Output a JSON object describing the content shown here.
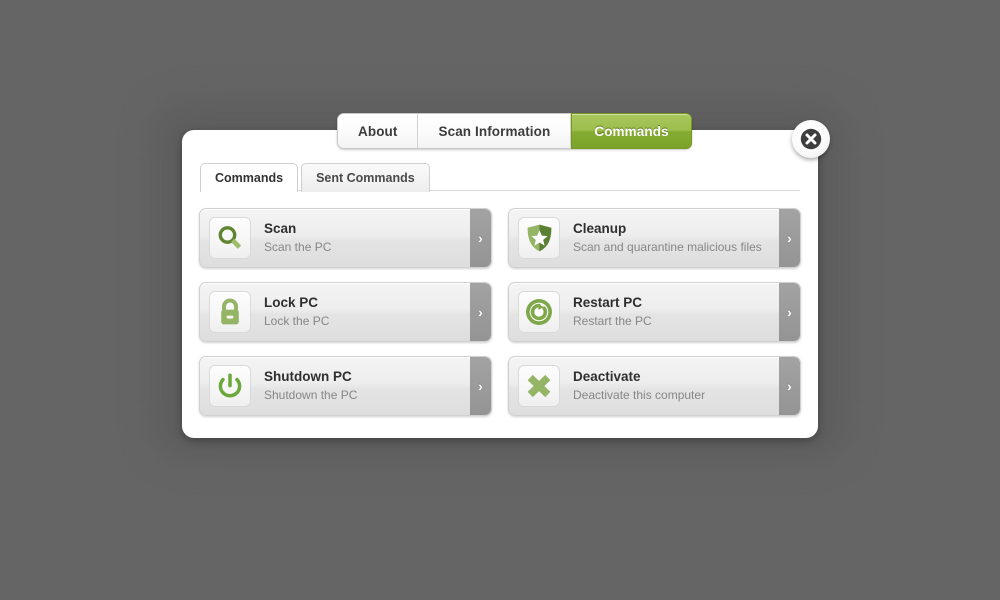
{
  "top_tabs": [
    {
      "label": "About",
      "active": false
    },
    {
      "label": "Scan Information",
      "active": false
    },
    {
      "label": "Commands",
      "active": true
    }
  ],
  "close_button": {
    "icon": "close-x-icon",
    "title": "Close"
  },
  "inner_tabs": [
    {
      "label": "Commands",
      "active": true
    },
    {
      "label": "Sent Commands",
      "active": false
    }
  ],
  "commands": [
    {
      "title": "Scan",
      "description": "Scan the PC",
      "icon": "magnifier-icon",
      "arrow": "›"
    },
    {
      "title": "Cleanup",
      "description": "Scan and quarantine malicious files",
      "icon": "shield-star-icon",
      "arrow": "›"
    },
    {
      "title": "Lock PC",
      "description": "Lock the PC",
      "icon": "padlock-icon",
      "arrow": "›"
    },
    {
      "title": "Restart PC",
      "description": "Restart the PC",
      "icon": "restart-circle-icon",
      "arrow": "›"
    },
    {
      "title": "Shutdown PC",
      "description": "Shutdown the PC",
      "icon": "power-icon",
      "arrow": "›"
    },
    {
      "title": "Deactivate",
      "description": "Deactivate this computer",
      "icon": "cross-x-icon",
      "arrow": "›"
    }
  ],
  "colors": {
    "background": "#656565",
    "accent_green": "#86ac31",
    "accent_green_light": "#a8c85c",
    "icon_green_dark": "#5f8430",
    "icon_green_light": "#9dbd6b",
    "panel_white": "#ffffff",
    "arrow_gray": "#9b9b9b",
    "title_text": "#2f2f2f",
    "desc_text": "#868686"
  }
}
